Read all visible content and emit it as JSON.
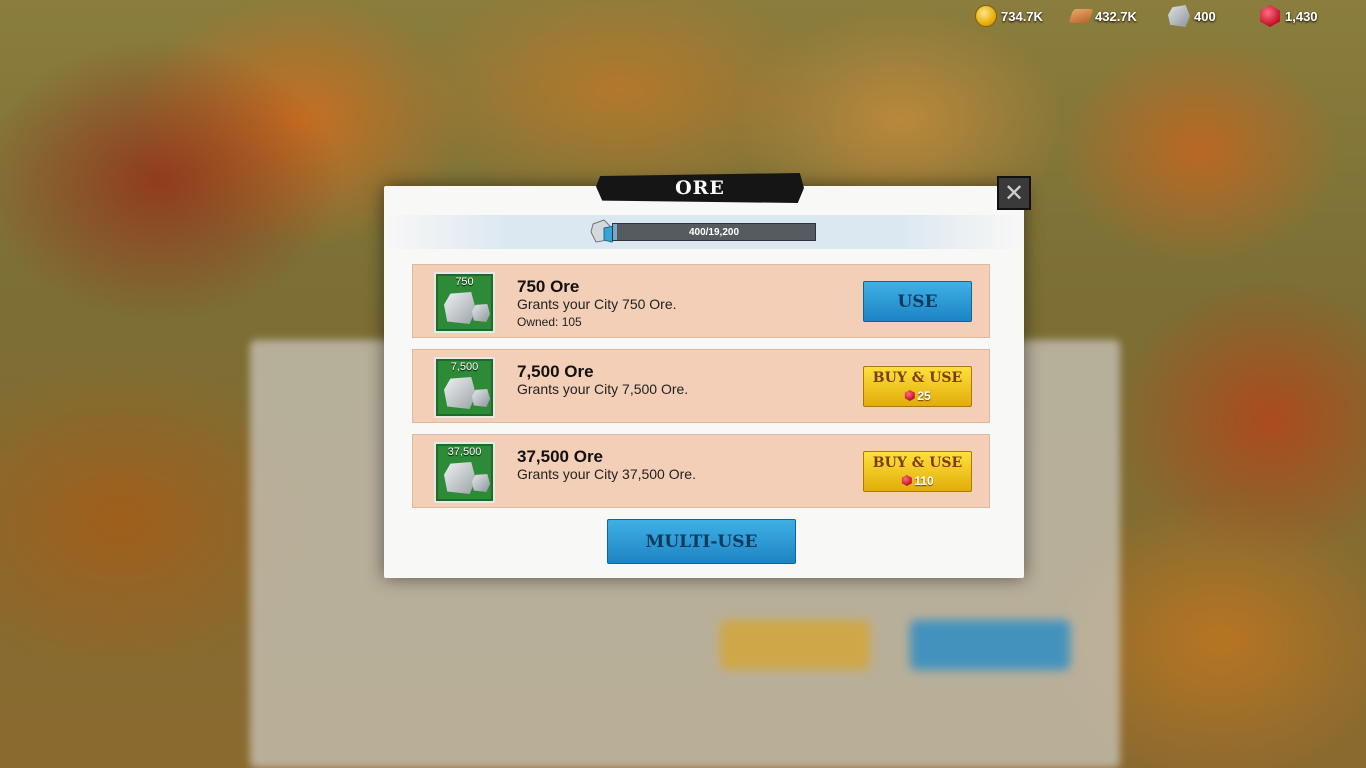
{
  "resources": [
    {
      "icon": "gold-coin-icon",
      "value": "734.7K"
    },
    {
      "icon": "lumber-icon",
      "value": "432.7K"
    },
    {
      "icon": "ore-icon",
      "value": "400"
    },
    {
      "icon": "gem-icon",
      "value": "1,430"
    }
  ],
  "dialog": {
    "title": "ORE",
    "close_icon": "close-icon",
    "capacity": {
      "text": "400/19,200",
      "current": 400,
      "max": 19200,
      "icon": "ore-icon"
    }
  },
  "items": [
    {
      "thumb_qty": "750",
      "name": "750 Ore",
      "description": "Grants your City 750 Ore.",
      "owned": "Owned: 105",
      "button": {
        "label": "USE"
      }
    },
    {
      "thumb_qty": "7,500",
      "name": "7,500 Ore",
      "description": "Grants your City 7,500 Ore.",
      "button": {
        "label": "BUY & USE",
        "cost": "25",
        "cost_icon": "gem-icon"
      }
    },
    {
      "thumb_qty": "37,500",
      "name": "37,500 Ore",
      "description": "Grants your City 37,500 Ore.",
      "button": {
        "label": "BUY & USE",
        "cost": "110",
        "cost_icon": "gem-icon"
      }
    }
  ],
  "footer": {
    "multi_use_label": "MULTI-USE"
  },
  "colors": {
    "use_button": "#1d84c4",
    "buy_button": "#e1ad0a",
    "row_bg": "#f3cfb7",
    "thumb_bg": "#2d8a36"
  }
}
